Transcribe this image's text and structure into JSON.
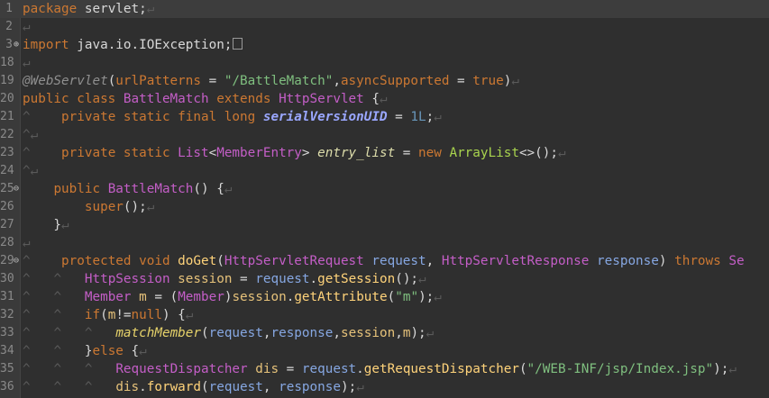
{
  "editor": {
    "line_numbers": [
      "1",
      "2",
      "3",
      "18",
      "19",
      "20",
      "21",
      "22",
      "23",
      "24",
      "25",
      "26",
      "27",
      "28",
      "29",
      "30",
      "31",
      "32",
      "33",
      "34",
      "35",
      "36"
    ],
    "fold_markers": {
      "3": "⊕",
      "25": "⊖",
      "29": "⊖"
    },
    "whitespace_marker": "↵",
    "tab_marker": "^",
    "lines": [
      [
        [
          "kw",
          "package"
        ],
        [
          "p",
          " servlet;"
        ],
        [
          "ws",
          "↵"
        ]
      ],
      [
        [
          "ws",
          "↵"
        ]
      ],
      [
        [
          "kw",
          "import"
        ],
        [
          "p",
          " java.io.IOException;"
        ],
        [
          "box",
          ""
        ]
      ],
      [
        [
          "ws",
          "↵"
        ]
      ],
      [
        [
          "an",
          "@WebServlet"
        ],
        [
          "p",
          "("
        ],
        [
          "at",
          "urlPatterns"
        ],
        [
          "p",
          " = "
        ],
        [
          "str",
          "\"/BattleMatch\""
        ],
        [
          "p",
          ","
        ],
        [
          "at",
          "asyncSupported"
        ],
        [
          "p",
          " = "
        ],
        [
          "kw",
          "true"
        ],
        [
          "p",
          ")"
        ],
        [
          "ws",
          "↵"
        ]
      ],
      [
        [
          "kw",
          "public class"
        ],
        [
          "p",
          " "
        ],
        [
          "ty",
          "BattleMatch"
        ],
        [
          "p",
          " "
        ],
        [
          "kw",
          "extends"
        ],
        [
          "p",
          " "
        ],
        [
          "ty",
          "HttpServlet"
        ],
        [
          "p",
          " {"
        ],
        [
          "ws",
          "↵"
        ]
      ],
      [
        [
          "ws",
          "^"
        ],
        [
          "p",
          "    "
        ],
        [
          "kw",
          "private static final long"
        ],
        [
          "p",
          " "
        ],
        [
          "fd",
          "serialVersionUID"
        ],
        [
          "p",
          " = "
        ],
        [
          "num",
          "1L"
        ],
        [
          "p",
          ";"
        ],
        [
          "ws",
          "↵"
        ]
      ],
      [
        [
          "ws",
          "^"
        ],
        [
          "ws",
          "↵"
        ]
      ],
      [
        [
          "ws",
          "^"
        ],
        [
          "p",
          "    "
        ],
        [
          "kw",
          "private static"
        ],
        [
          "p",
          " "
        ],
        [
          "ty",
          "List"
        ],
        [
          "p",
          "<"
        ],
        [
          "ty",
          "MemberEntry"
        ],
        [
          "p",
          "> "
        ],
        [
          "fdi",
          "entry_list"
        ],
        [
          "p",
          " = "
        ],
        [
          "kw",
          "new"
        ],
        [
          "p",
          " "
        ],
        [
          "gn",
          "ArrayList"
        ],
        [
          "p",
          "<>();"
        ],
        [
          "ws",
          "↵"
        ]
      ],
      [
        [
          "ws",
          "^"
        ],
        [
          "ws",
          "↵"
        ]
      ],
      [
        [
          "p",
          "    "
        ],
        [
          "kw",
          "public"
        ],
        [
          "p",
          " "
        ],
        [
          "ty",
          "BattleMatch"
        ],
        [
          "p",
          "() {"
        ],
        [
          "ws",
          "↵"
        ]
      ],
      [
        [
          "p",
          "        "
        ],
        [
          "kw",
          "super"
        ],
        [
          "p",
          "();"
        ],
        [
          "ws",
          "↵"
        ]
      ],
      [
        [
          "p",
          "    }"
        ],
        [
          "ws",
          "↵"
        ]
      ],
      [
        [
          "ws",
          "↵"
        ]
      ],
      [
        [
          "ws",
          "^"
        ],
        [
          "p",
          "    "
        ],
        [
          "kw",
          "protected void"
        ],
        [
          "p",
          " "
        ],
        [
          "md",
          "doGet"
        ],
        [
          "p",
          "("
        ],
        [
          "ty",
          "HttpServletRequest"
        ],
        [
          "p",
          " "
        ],
        [
          "pm",
          "request"
        ],
        [
          "p",
          ", "
        ],
        [
          "ty",
          "HttpServletResponse"
        ],
        [
          "p",
          " "
        ],
        [
          "pm",
          "response"
        ],
        [
          "p",
          ") "
        ],
        [
          "kw",
          "throws"
        ],
        [
          "p",
          " "
        ],
        [
          "ty",
          "Se"
        ]
      ],
      [
        [
          "ws",
          "^"
        ],
        [
          "p",
          "   "
        ],
        [
          "ws",
          "^"
        ],
        [
          "p",
          "   "
        ],
        [
          "ty",
          "HttpSession"
        ],
        [
          "p",
          " "
        ],
        [
          "vr",
          "session"
        ],
        [
          "p",
          " = "
        ],
        [
          "pm",
          "request"
        ],
        [
          "p",
          "."
        ],
        [
          "md",
          "getSession"
        ],
        [
          "p",
          "();"
        ],
        [
          "ws",
          "↵"
        ]
      ],
      [
        [
          "ws",
          "^"
        ],
        [
          "p",
          "   "
        ],
        [
          "ws",
          "^"
        ],
        [
          "p",
          "   "
        ],
        [
          "ty",
          "Member"
        ],
        [
          "p",
          " "
        ],
        [
          "vr",
          "m"
        ],
        [
          "p",
          " = ("
        ],
        [
          "ty",
          "Member"
        ],
        [
          "p",
          ")"
        ],
        [
          "vr",
          "session"
        ],
        [
          "p",
          "."
        ],
        [
          "md",
          "getAttribute"
        ],
        [
          "p",
          "("
        ],
        [
          "str",
          "\"m\""
        ],
        [
          "p",
          ");"
        ],
        [
          "ws",
          "↵"
        ]
      ],
      [
        [
          "ws",
          "^"
        ],
        [
          "p",
          "   "
        ],
        [
          "ws",
          "^"
        ],
        [
          "p",
          "   "
        ],
        [
          "kw",
          "if"
        ],
        [
          "p",
          "("
        ],
        [
          "vr",
          "m"
        ],
        [
          "p",
          "!="
        ],
        [
          "kw",
          "null"
        ],
        [
          "p",
          ") {"
        ],
        [
          "ws",
          "↵"
        ]
      ],
      [
        [
          "ws",
          "^"
        ],
        [
          "p",
          "   "
        ],
        [
          "ws",
          "^"
        ],
        [
          "p",
          "   "
        ],
        [
          "ws",
          "^"
        ],
        [
          "p",
          "   "
        ],
        [
          "mi",
          "matchMember"
        ],
        [
          "p",
          "("
        ],
        [
          "pm",
          "request"
        ],
        [
          "p",
          ","
        ],
        [
          "pm",
          "response"
        ],
        [
          "p",
          ","
        ],
        [
          "vr",
          "session"
        ],
        [
          "p",
          ","
        ],
        [
          "vr",
          "m"
        ],
        [
          "p",
          ");"
        ],
        [
          "ws",
          "↵"
        ]
      ],
      [
        [
          "ws",
          "^"
        ],
        [
          "p",
          "   "
        ],
        [
          "ws",
          "^"
        ],
        [
          "p",
          "   "
        ],
        [
          "p",
          "}"
        ],
        [
          "kw",
          "else"
        ],
        [
          "p",
          " {"
        ],
        [
          "ws",
          "↵"
        ]
      ],
      [
        [
          "ws",
          "^"
        ],
        [
          "p",
          "   "
        ],
        [
          "ws",
          "^"
        ],
        [
          "p",
          "   "
        ],
        [
          "ws",
          "^"
        ],
        [
          "p",
          "   "
        ],
        [
          "ty",
          "RequestDispatcher"
        ],
        [
          "p",
          " "
        ],
        [
          "vr",
          "dis"
        ],
        [
          "p",
          " = "
        ],
        [
          "pm",
          "request"
        ],
        [
          "p",
          "."
        ],
        [
          "md",
          "getRequestDispatcher"
        ],
        [
          "p",
          "("
        ],
        [
          "str",
          "\"/WEB-INF/jsp/Index.jsp\""
        ],
        [
          "p",
          ");"
        ],
        [
          "ws",
          "↵"
        ]
      ],
      [
        [
          "ws",
          "^"
        ],
        [
          "p",
          "   "
        ],
        [
          "ws",
          "^"
        ],
        [
          "p",
          "   "
        ],
        [
          "ws",
          "^"
        ],
        [
          "p",
          "   "
        ],
        [
          "vr",
          "dis"
        ],
        [
          "p",
          "."
        ],
        [
          "md",
          "forward"
        ],
        [
          "p",
          "("
        ],
        [
          "pm",
          "request"
        ],
        [
          "p",
          ", "
        ],
        [
          "pm",
          "response"
        ],
        [
          "p",
          ");"
        ],
        [
          "ws",
          "↵"
        ]
      ]
    ]
  }
}
